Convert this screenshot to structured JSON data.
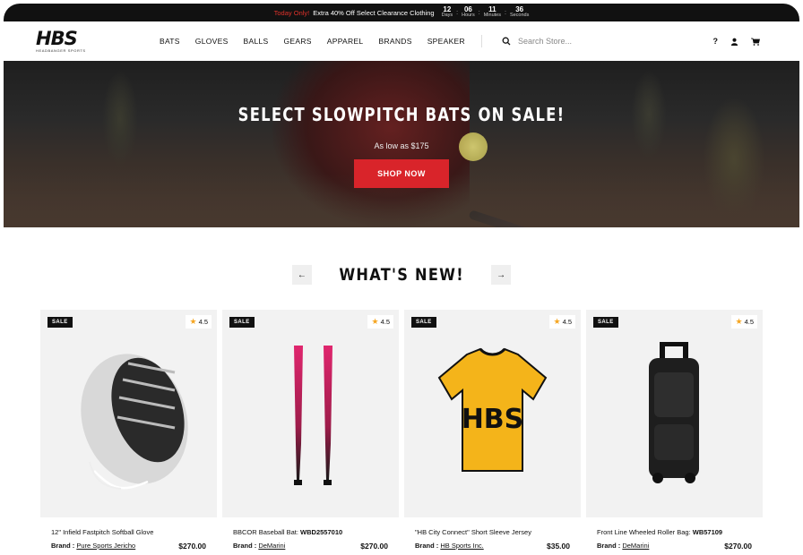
{
  "promo": {
    "highlight": "Today Only!",
    "text": "Extra 40% Off Select Clearance Clothing",
    "countdown": [
      {
        "value": "12",
        "label": "Days"
      },
      {
        "value": "06",
        "label": "Hours"
      },
      {
        "value": "11",
        "label": "Minutes"
      },
      {
        "value": "36",
        "label": "Seconds"
      }
    ]
  },
  "logo": {
    "mark": "HBS",
    "sub": "HEADBANGER SPORTS"
  },
  "nav": [
    "BATS",
    "GLOVES",
    "BALLS",
    "GEARS",
    "APPAREL",
    "BRANDS",
    "SPEAKER"
  ],
  "search": {
    "placeholder": "Search Store..."
  },
  "header_icons": [
    "help-icon",
    "user-icon",
    "cart-icon"
  ],
  "hero": {
    "title": "SELECT SLOWPITCH BATS ON SALE!",
    "subtitle": "As low as $175",
    "cta": "SHOP NOW"
  },
  "section": {
    "title": "WHAT'S NEW!",
    "prev": "←",
    "next": "→"
  },
  "products": [
    {
      "badge": "SALE",
      "rating": "4.5",
      "title": "12\" Infield Fastpitch Softball Glove",
      "title_bold": "",
      "brand_label": "Brand :",
      "brand": "Pure Sports Jericho",
      "price": "$270.00"
    },
    {
      "badge": "SALE",
      "rating": "4.5",
      "title": "BBCOR Baseball Bat: ",
      "title_bold": "WBD2557010",
      "brand_label": "Brand :",
      "brand": "DeMarini",
      "price": "$270.00"
    },
    {
      "badge": "SALE",
      "rating": "4.5",
      "title": "\"HB City Connect\" Short Sleeve Jersey",
      "title_bold": "",
      "brand_label": "Brand :",
      "brand": "HB Sports Inc.",
      "price": "$35.00",
      "jersey_text": "HBS"
    },
    {
      "badge": "SALE",
      "rating": "4.5",
      "title": "Front Line Wheeled Roller Bag: ",
      "title_bold": "WB57109",
      "brand_label": "Brand :",
      "brand": "DeMarini",
      "price": "$270.00"
    }
  ],
  "colors": {
    "accent": "#d9242a",
    "star": "#f5a623",
    "dark": "#111111"
  }
}
